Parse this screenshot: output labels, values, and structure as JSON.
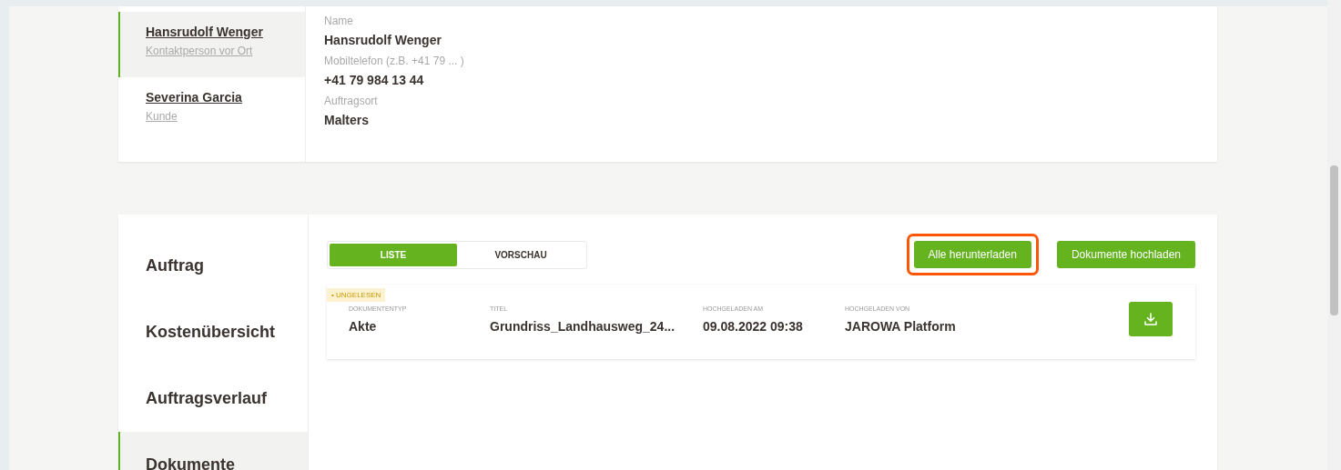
{
  "contacts": [
    {
      "name": "Hansrudolf Wenger",
      "role": "Kontaktperson vor Ort",
      "selected": true
    },
    {
      "name": "Severina Garcia",
      "role": "Kunde",
      "selected": false
    }
  ],
  "details": [
    {
      "label": "Name",
      "value": "Hansrudolf Wenger"
    },
    {
      "label": "Mobiltelefon (z.B. +41 79 ... )",
      "value": "+41 79 984 13 44"
    },
    {
      "label": "Auftragsort",
      "value": "Malters"
    }
  ],
  "nav": [
    {
      "label": "Auftrag",
      "selected": false
    },
    {
      "label": "Kostenübersicht",
      "selected": false
    },
    {
      "label": "Auftragsverlauf",
      "selected": false
    },
    {
      "label": "Dokumente",
      "selected": true
    }
  ],
  "view_toggle": [
    {
      "label": "LISTE",
      "selected": true
    },
    {
      "label": "VORSCHAU",
      "selected": false
    }
  ],
  "buttons": [
    {
      "label": "Alle herunterladen",
      "highlighted": true
    },
    {
      "label": "Dokumente hochladen",
      "highlighted": false
    }
  ],
  "documents": [
    {
      "badge": "• UNGELESEN",
      "fields": [
        {
          "label": "DOKUMENTENTYP",
          "value": "Akte"
        },
        {
          "label": "TITEL",
          "value": "Grundriss_Landhausweg_24..."
        },
        {
          "label": "HOCHGELADEN AM",
          "value": "09.08.2022 09:38"
        },
        {
          "label": "HOCHGELADEN VON",
          "value": "JAROWA Platform"
        }
      ]
    }
  ]
}
